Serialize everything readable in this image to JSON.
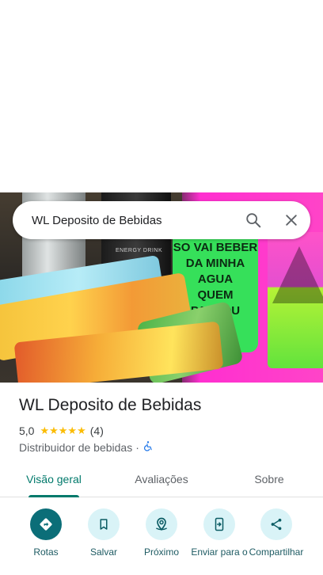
{
  "colors": {
    "accent": "#00796b",
    "primary_action": "#0b6e78",
    "action_bg": "#d9f3f7",
    "star": "#fbbc04"
  },
  "photo": {
    "cup_text": [
      "SO VAI BEBER",
      "DA MINHA AGUA",
      "QUEM PASSOU"
    ],
    "can_text": "ENERGY DRINK",
    "icon": "place-photo"
  },
  "search": {
    "query": "WL Deposito de Bebidas",
    "search_icon": "search-icon",
    "close_icon": "close-icon"
  },
  "place": {
    "name": "WL Deposito de Bebidas",
    "rating": "5,0",
    "stars": "★★★★★",
    "reviews": "(4)",
    "category": "Distribuidor de bebidas",
    "separator": "·",
    "accessibility_icon": "wheelchair-icon"
  },
  "tabs": [
    {
      "label": "Visão geral",
      "active": true
    },
    {
      "label": "Avaliações",
      "active": false
    },
    {
      "label": "Sobre",
      "active": false
    }
  ],
  "actions": [
    {
      "label": "Rotas",
      "icon": "directions-icon"
    },
    {
      "label": "Salvar",
      "icon": "bookmark-icon"
    },
    {
      "label": "Próximo",
      "icon": "nearby-icon"
    },
    {
      "label": "Enviar para o",
      "icon": "send-to-phone-icon"
    },
    {
      "label": "Compartilhar",
      "icon": "share-icon"
    }
  ]
}
